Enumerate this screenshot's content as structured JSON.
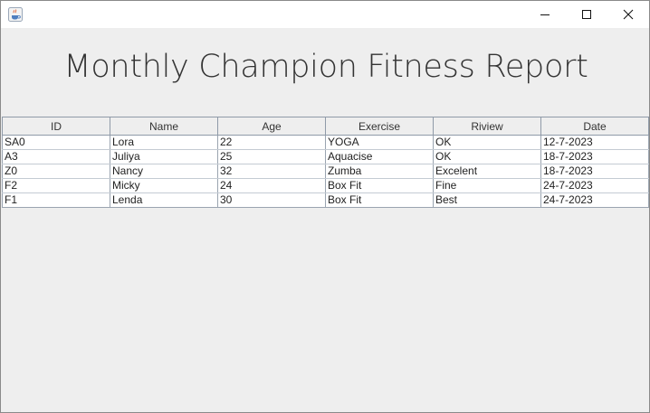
{
  "window": {
    "title": "",
    "icon": "java-coffee-icon",
    "controls": {
      "minimize_icon": "minimize-icon",
      "maximize_icon": "maximize-icon",
      "close_icon": "close-icon"
    }
  },
  "report": {
    "title": "Monthly Champion Fitness Report"
  },
  "table": {
    "columns": [
      "ID",
      "Name",
      "Age",
      "Exercise",
      "Riview",
      "Date"
    ],
    "rows": [
      [
        "SA0",
        "Lora",
        "22",
        "YOGA",
        "OK",
        "12-7-2023"
      ],
      [
        "A3",
        "Juliya",
        "25",
        "Aquacise",
        "OK",
        "18-7-2023"
      ],
      [
        "Z0",
        "Nancy",
        "32",
        "Zumba",
        "Excelent",
        "18-7-2023"
      ],
      [
        "F2",
        "Micky",
        "24",
        "Box Fit",
        "Fine",
        "24-7-2023"
      ],
      [
        "F1",
        "Lenda",
        "30",
        "Box Fit",
        "Best",
        "24-7-2023"
      ]
    ]
  },
  "colors": {
    "background": "#eeeeee",
    "titlebar": "#ffffff",
    "grid": "#9aa4b0",
    "cell": "#ffffff"
  }
}
